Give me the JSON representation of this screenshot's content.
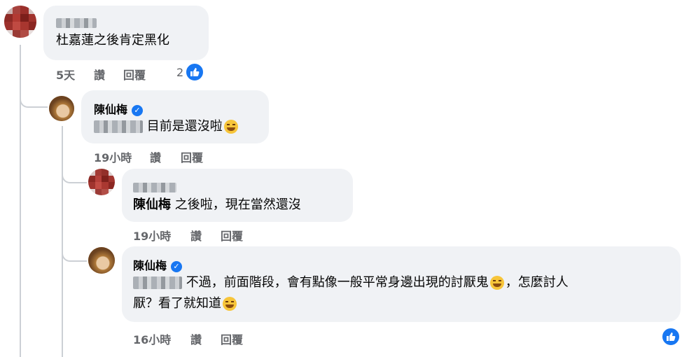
{
  "comments": [
    {
      "author": "",
      "text": "杜嘉蓮之後肯定黑化",
      "time": "5天",
      "like": "讚",
      "reply": "回覆",
      "reaction_count": "2"
    },
    {
      "author": "陳仙梅",
      "text": "目前是還沒啦",
      "time": "19小時",
      "like": "讚",
      "reply": "回覆"
    },
    {
      "author": "",
      "mention": "陳仙梅",
      "text": "之後啦，現在當然還沒",
      "time": "19小時",
      "like": "讚",
      "reply": "回覆"
    },
    {
      "author": "陳仙梅",
      "text_line1a": "不過，前面階段，會有點像一般平常身邊出現的討厭鬼",
      "text_line1b": "，怎麼討人",
      "text_line2": "厭？看了就知道",
      "time": "16小時",
      "like": "讚",
      "reply": "回覆"
    }
  ],
  "colors": {
    "accent": "#1877f2",
    "bubble": "#f0f2f5",
    "meta": "#65676b",
    "thread_line": "#ccd0d5"
  },
  "icons": [
    "verified-badge-icon",
    "like-reaction-icon",
    "grinning-emoji-icon",
    "sweat-smile-emoji-icon"
  ]
}
